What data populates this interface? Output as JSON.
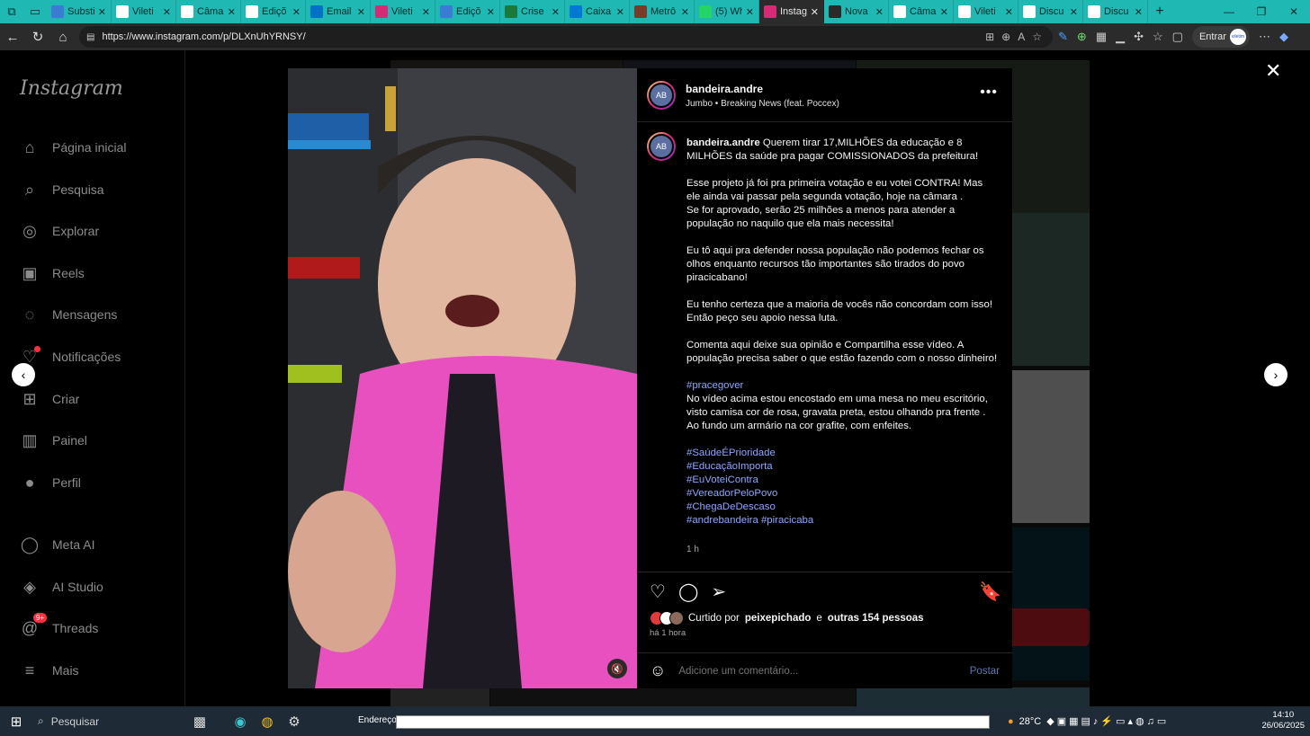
{
  "browser": {
    "tabs": [
      {
        "label": "Substi",
        "color": "#3a7bd5",
        "active": false
      },
      {
        "label": "Vileti",
        "color": "#ffffff",
        "active": false
      },
      {
        "label": "Câmar",
        "color": "#ffffff",
        "active": false
      },
      {
        "label": "Ediçõ",
        "color": "#ffffff",
        "active": false
      },
      {
        "label": "Email",
        "color": "#0072c6",
        "active": false
      },
      {
        "label": "Vileti",
        "color": "#d62976",
        "active": false
      },
      {
        "label": "Ediçõ",
        "color": "#3a7bd5",
        "active": false
      },
      {
        "label": "Crise",
        "color": "#1b7a3b",
        "active": false
      },
      {
        "label": "Caixa",
        "color": "#0078d4",
        "active": false
      },
      {
        "label": "Metrô",
        "color": "#7a3c2a",
        "active": false
      },
      {
        "label": "(5) Wh",
        "color": "#25d366",
        "active": false
      },
      {
        "label": "Instag",
        "color": "#d62976",
        "active": true
      },
      {
        "label": "Nova",
        "color": "#2b2b2b",
        "active": false
      },
      {
        "label": "Câma",
        "color": "#ffffff",
        "active": false
      },
      {
        "label": "Vileti",
        "color": "#ffffff",
        "active": false
      },
      {
        "label": "Discu",
        "color": "#ffffff",
        "active": false
      },
      {
        "label": "Discu",
        "color": "#ffffff",
        "active": false
      }
    ],
    "url": "https://www.instagram.com/p/DLXnUhYRNSY/",
    "signin_label": "Entrar",
    "profile_label": "viletim"
  },
  "sidebar": {
    "logo": "Instagram",
    "items": [
      {
        "label": "Página inicial",
        "icon": "⌂"
      },
      {
        "label": "Pesquisa",
        "icon": "⌕"
      },
      {
        "label": "Explorar",
        "icon": "◎"
      },
      {
        "label": "Reels",
        "icon": "▣"
      },
      {
        "label": "Mensagens",
        "icon": "◌"
      },
      {
        "label": "Notificações",
        "icon": "♡"
      },
      {
        "label": "Criar",
        "icon": "⊞"
      },
      {
        "label": "Painel",
        "icon": "▥"
      },
      {
        "label": "Perfil",
        "icon": "●"
      },
      {
        "label": "Meta AI",
        "icon": "◯"
      },
      {
        "label": "AI Studio",
        "icon": "◈"
      },
      {
        "label": "Threads",
        "icon": "@"
      },
      {
        "label": "Mais",
        "icon": "≡"
      }
    ],
    "threads_badge": "9+"
  },
  "post": {
    "username": "bandeira.andre",
    "music_artist": "Jumbo",
    "music_separator": "•",
    "music_track": "Breaking News (feat. Poccex)",
    "caption_user": "bandeira.andre",
    "caption_p1": "Querem tirar 17,MILHÕES da educação e 8 MILHÕES da saúde pra pagar COMISSIONADOS da prefeitura!",
    "caption_p2": "Esse projeto já foi pra primeira votação e eu votei CONTRA! Mas ele ainda vai passar pela segunda votação, hoje na câmara .",
    "caption_p2b": "Se for aprovado, serão 25 milhões a menos para atender a população no naquilo que ela mais necessita!",
    "caption_p3": "Eu tô aqui pra defender nossa população não podemos fechar os olhos enquanto recursos tão importantes são tirados do povo piracicabano!",
    "caption_p4": "Eu tenho certeza que a maioria de vocês não concordam com isso! Então peço seu apoio nessa luta.",
    "caption_p5": "Comenta aqui deixe sua opinião e Compartilha esse vídeo. A população precisa saber o que estão fazendo com o nosso dinheiro!",
    "tag_pracegover": "#pracegover",
    "caption_p6": "No vídeo acima estou encostado em uma mesa no meu escritório, visto camisa cor de rosa, gravata preta, estou olhando pra frente . Ao fundo um armário na cor grafite, com enfeites.",
    "hashtags": [
      "#SaúdeÉPrioridade",
      "#EducaçãoImporta",
      "#EuVoteiContra",
      "#VereadorPeloPovo",
      "#ChegaDeDescaso",
      "#andrebandeira #piracicaba"
    ],
    "caption_time": "1 h",
    "likes_prefix": "Curtido por",
    "likes_user": "peixepichado",
    "likes_and": "e",
    "likes_others": "outras 154 pessoas",
    "posted_ago": "há 1 hora",
    "comment_placeholder": "Adicione um comentário...",
    "post_button": "Postar"
  },
  "taskbar": {
    "search_label": "Pesquisar",
    "address_label": "Endereço",
    "temperature": "28°C",
    "time": "14:10",
    "date": "26/06/2025"
  }
}
